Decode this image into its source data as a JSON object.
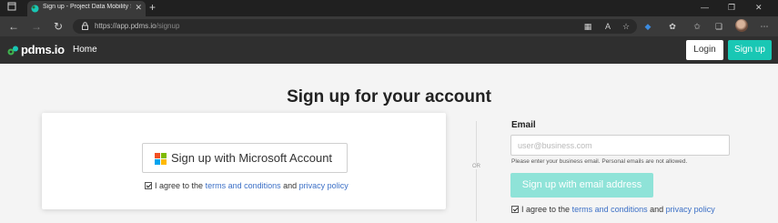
{
  "browser": {
    "tab_title": "Sign up - Project Data Mobility S",
    "new_tab_glyph": "+",
    "close_tab_glyph": "✕",
    "url_host": "https://app.pdms.io",
    "url_path": "/signup",
    "window_controls": [
      "—",
      "❐",
      "✕"
    ],
    "nav": {
      "back": "←",
      "forward": "→",
      "reload": "↻"
    },
    "toolbar_icons": [
      "grid-icon",
      "read-aloud-icon",
      "favorite-star-icon",
      "extension-icon",
      "puzzle-icon",
      "favorites-icon",
      "collections-icon",
      "profile-avatar"
    ]
  },
  "site": {
    "brand": "pdms.io",
    "home_link": "Home",
    "login_label": "Login",
    "signup_label": "Sign up"
  },
  "main": {
    "title": "Sign up for your account",
    "microsoft_button": "Sign up with Microsoft Account",
    "agree_prefix": "I agree to the",
    "terms_link": "terms and conditions",
    "and_text": "and",
    "privacy_link": "privacy policy",
    "or_label": "OR",
    "email_label": "Email",
    "email_placeholder": "user@business.com",
    "email_value": "",
    "email_hint": "Please enter your business email. Personal emails are not allowed.",
    "email_button": "Sign up with email address"
  },
  "colors": {
    "accent": "#19c7b4",
    "accent_disabled": "#8fe3d8",
    "header_bg": "#2f2f2f",
    "link": "#3b6fc6"
  }
}
